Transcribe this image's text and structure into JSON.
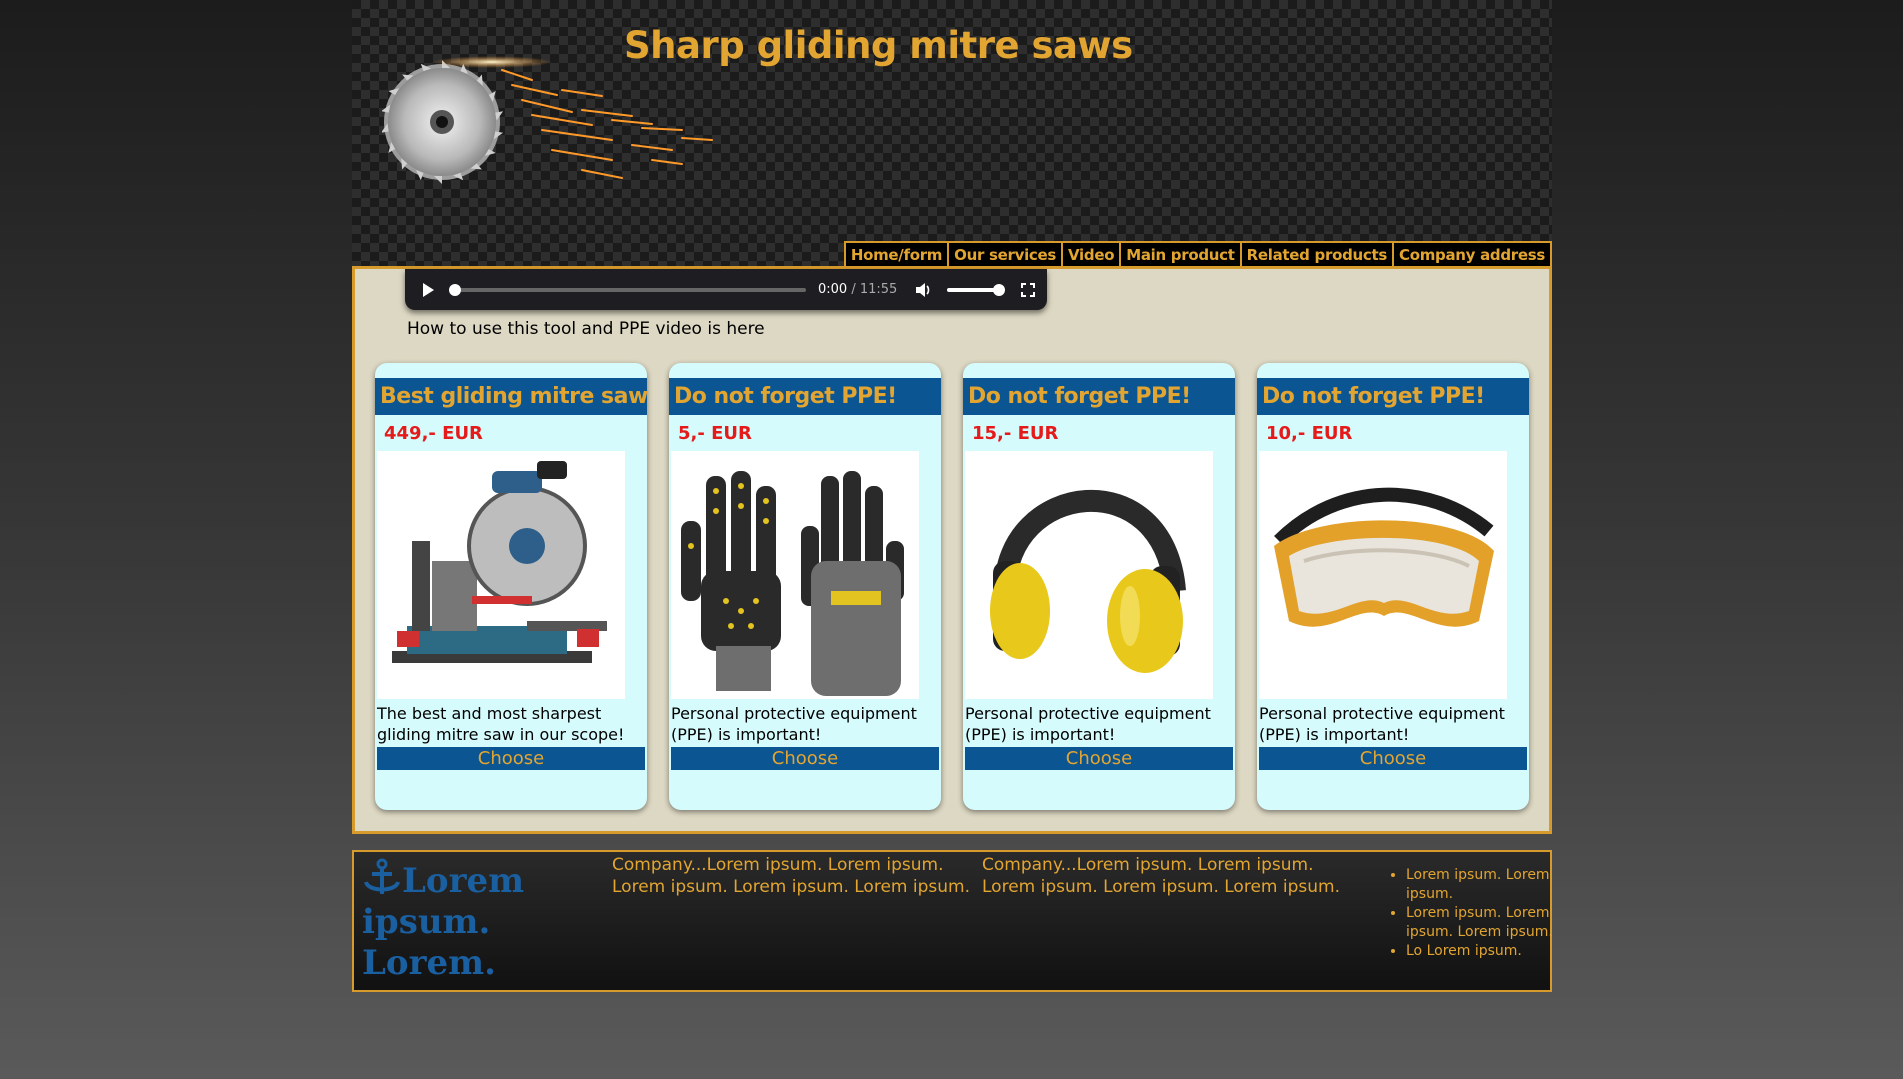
{
  "header": {
    "title": "Sharp gliding mitre saws"
  },
  "nav": {
    "items": [
      {
        "label": "Home/form"
      },
      {
        "label": "Our services"
      },
      {
        "label": "Video"
      },
      {
        "label": "Main product"
      },
      {
        "label": "Related products"
      },
      {
        "label": "Company address"
      }
    ]
  },
  "video": {
    "current_time": "0:00",
    "separator": " / ",
    "duration": "11:55",
    "caption": "How to use this tool and PPE video is here",
    "icons": [
      "play-icon",
      "volume-icon",
      "fullscreen-icon"
    ]
  },
  "products": [
    {
      "title": "Best gliding mitre saw",
      "price": "449,- EUR",
      "description": "The best and most sharpest gliding mitre saw in our scope!",
      "button": "Choose",
      "image": "mitre-saw-image"
    },
    {
      "title": "Do not forget PPE!",
      "price": "5,- EUR",
      "description": "Personal protective equipment (PPE) is important!",
      "button": "Choose",
      "image": "gloves-image"
    },
    {
      "title": "Do not forget PPE!",
      "price": "15,- EUR",
      "description": "Personal protective equipment (PPE) is important!",
      "button": "Choose",
      "image": "earmuffs-image"
    },
    {
      "title": "Do not forget PPE!",
      "price": "10,- EUR",
      "description": "Personal protective equipment (PPE) is important!",
      "button": "Choose",
      "image": "goggles-image"
    }
  ],
  "footer": {
    "logo_text": "Lorem ipsum. Lorem.",
    "col1": "Company...Lorem ipsum. Lorem ipsum. Lorem ipsum. Lorem ipsum. Lorem ipsum.",
    "col2": "Company...Lorem ipsum. Lorem ipsum. Lorem ipsum. Lorem ipsum. Lorem ipsum.",
    "list": [
      "Lorem ipsum. Lorem ipsum.",
      "Lorem ipsum. Lorem ipsum. Lorem ipsum.",
      "Lo Lorem ipsum."
    ]
  },
  "colors": {
    "accent": "#e2a531",
    "title_bar": "#0b5592",
    "price": "#e51a1a",
    "card_bg": "#d6fbfc",
    "main_bg": "#ddd8c3"
  }
}
